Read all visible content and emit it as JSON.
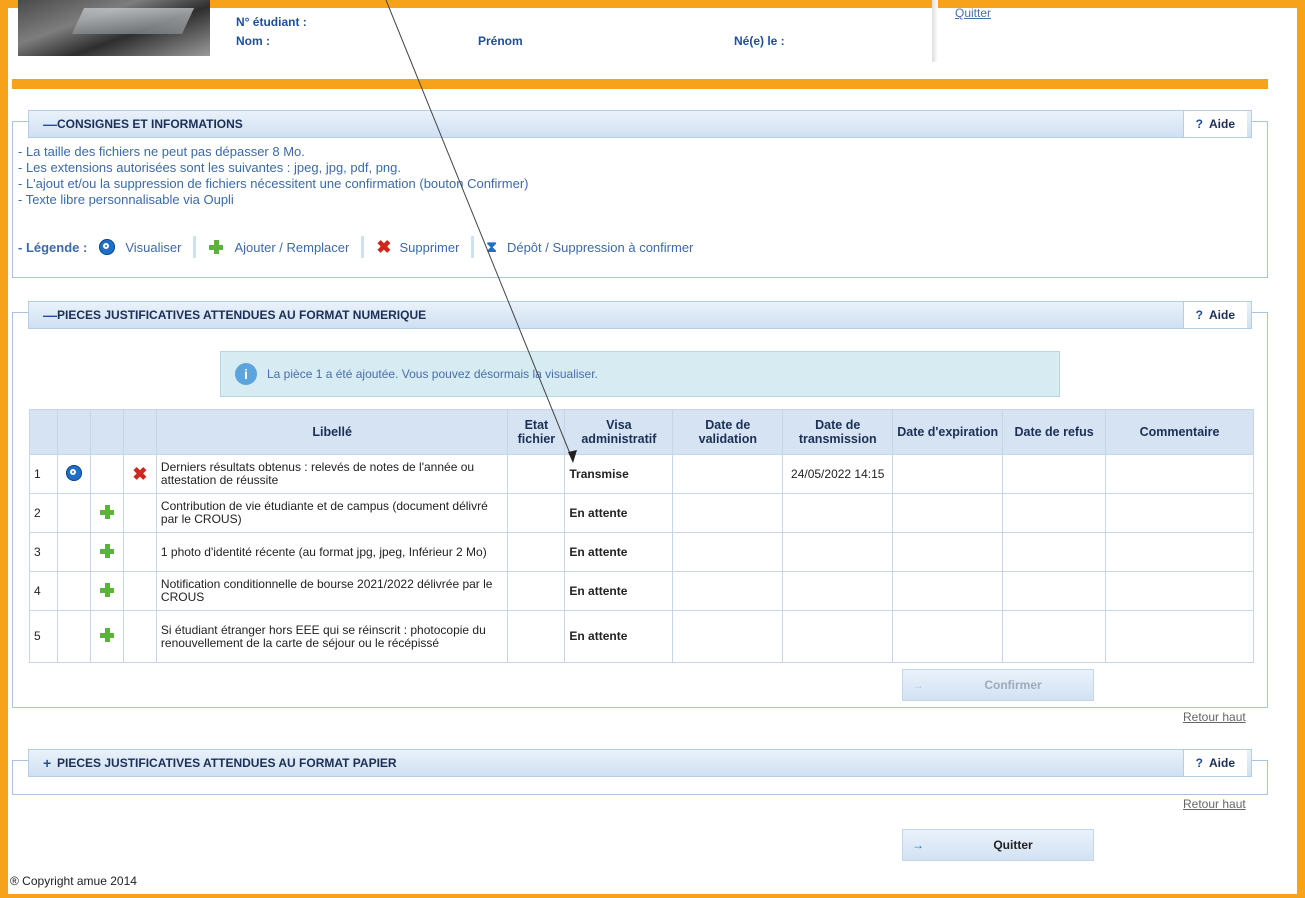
{
  "header": {
    "student_number_label": "N° étudiant :",
    "name_label": "Nom :",
    "firstname_label": "Prénom",
    "birth_label": "Né(e) le :",
    "quit_link": "Quitter"
  },
  "consignes": {
    "toggle": "—",
    "title": "CONSIGNES ET INFORMATIONS",
    "aide": "Aide",
    "lines": [
      "- La taille des fichiers ne peut pas dépasser 8 Mo.",
      "- Les extensions autorisées sont les suivantes : jpeg, jpg, pdf, png.",
      "- L'ajout et/ou la suppression de fichiers nécessitent une confirmation (bouton Confirmer)",
      "- Texte libre personnalisable via Oupli"
    ],
    "legend_label": "- Légende :",
    "legend_items": [
      "Visualiser",
      "Ajouter / Remplacer",
      "Supprimer",
      "Dépôt / Suppression à confirmer"
    ]
  },
  "numerique": {
    "toggle": "—",
    "title": "PIECES JUSTIFICATIVES ATTENDUES AU FORMAT NUMERIQUE",
    "aide": "Aide",
    "notice": "La pièce 1 a été ajoutée. Vous pouvez désormais la visualiser.",
    "columns": [
      "Libellé",
      "Etat fichier",
      "Visa administratif",
      "Date de validation",
      "Date de transmission",
      "Date d'expiration",
      "Date de refus",
      "Commentaire"
    ],
    "rows": [
      {
        "num": "1",
        "label": "Derniers résultats obtenus : relevés de notes de l'année ou attestation de réussite",
        "etat": "",
        "visa": "Transmise",
        "validation": "",
        "transmission": "24/05/2022 14:15",
        "expiration": "",
        "refus": "",
        "commentaire": ""
      },
      {
        "num": "2",
        "label": "Contribution de vie étudiante et de campus (document délivré par le CROUS)",
        "etat": "",
        "visa": "En attente",
        "validation": "",
        "transmission": "",
        "expiration": "",
        "refus": "",
        "commentaire": ""
      },
      {
        "num": "3",
        "label": "1 photo d'identité récente (au format jpg, jpeg, Inférieur 2 Mo)",
        "etat": "",
        "visa": "En attente",
        "validation": "",
        "transmission": "",
        "expiration": "",
        "refus": "",
        "commentaire": ""
      },
      {
        "num": "4",
        "label": "Notification conditionnelle de bourse 2021/2022 délivrée par le CROUS",
        "etat": "",
        "visa": "En attente",
        "validation": "",
        "transmission": "",
        "expiration": "",
        "refus": "",
        "commentaire": ""
      },
      {
        "num": "5",
        "label": "Si étudiant étranger hors EEE qui se réinscrit : photocopie du renouvellement de la carte de séjour ou le récépissé",
        "etat": "",
        "visa": "En attente",
        "validation": "",
        "transmission": "",
        "expiration": "",
        "refus": "",
        "commentaire": ""
      }
    ],
    "confirm_button": "Confirmer",
    "retour": "Retour haut"
  },
  "papier": {
    "toggle": "+",
    "title": "PIECES JUSTIFICATIVES ATTENDUES AU FORMAT PAPIER",
    "aide": "Aide",
    "retour": "Retour haut"
  },
  "footer": {
    "quit_button": "Quitter",
    "copyright": "® Copyright amue 2014"
  },
  "colors": {
    "accent": "#f7a21b",
    "primary": "#1f4e9a",
    "header_bg": "#d5e3f3"
  }
}
